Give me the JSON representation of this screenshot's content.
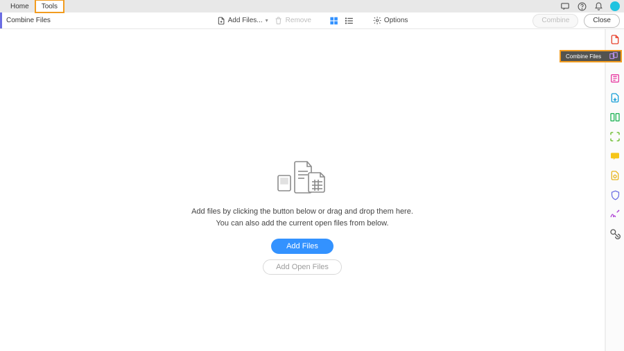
{
  "header": {
    "tabs": [
      {
        "label": "Home"
      },
      {
        "label": "Tools",
        "highlighted": true
      }
    ]
  },
  "toolbar": {
    "title": "Combine Files",
    "add_files_label": "Add Files...",
    "remove_label": "Remove",
    "options_label": "Options",
    "combine_label": "Combine",
    "close_label": "Close"
  },
  "main": {
    "instruction_line1": "Add files by clicking the button below or drag and drop them here.",
    "instruction_line2": "You can also add the current open files from below.",
    "add_files_btn": "Add Files",
    "add_open_files_btn": "Add Open Files"
  },
  "right_panel": {
    "combine_files_tooltip": "Combine Files"
  },
  "colors": {
    "accent_highlight": "#f29c1f",
    "primary": "#3392ff",
    "avatar": "#1ec3e0"
  }
}
